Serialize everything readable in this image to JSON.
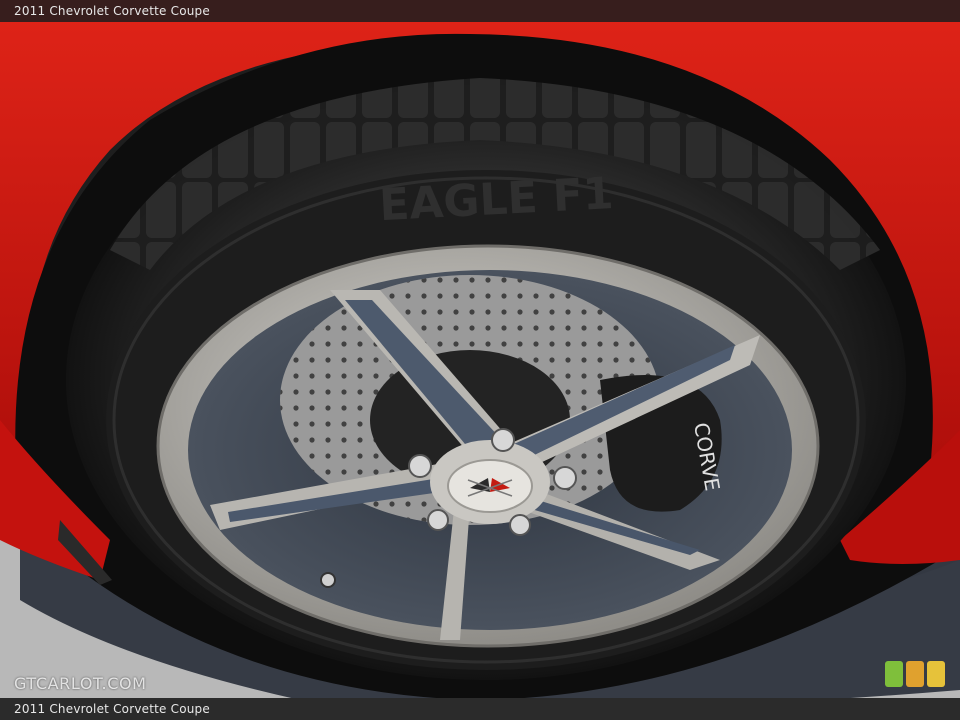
{
  "caption": {
    "top": "2011 Chevrolet Corvette Coupe",
    "bottom": "2011 Chevrolet Corvette Coupe"
  },
  "watermark": "GTCARLOT.COM",
  "caliper_text": "CORVE",
  "icons": {
    "logo": "corvette-crossed-flags-emblem",
    "badge": "three-color-bars-icon"
  },
  "colors": {
    "body_paint": "#c8100e",
    "tire": "#1a1a1a",
    "wheel_face": "#bdbbb6",
    "wheel_pocket": "#3c4450",
    "ground": "#a9a9a9"
  }
}
